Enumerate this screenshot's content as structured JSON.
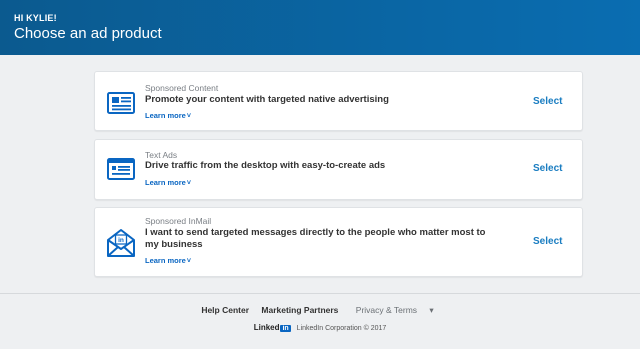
{
  "header": {
    "greeting": "HI KYLIE!",
    "title": "Choose an ad product"
  },
  "products": [
    {
      "kind": "Sponsored Content",
      "headline": "Promote your content with targeted native advertising",
      "learn_more": "Learn more",
      "select": "Select",
      "icon": "sponsored-content-icon"
    },
    {
      "kind": "Text Ads",
      "headline": "Drive traffic from the desktop with easy-to-create ads",
      "learn_more": "Learn more",
      "select": "Select",
      "icon": "text-ads-icon"
    },
    {
      "kind": "Sponsored InMail",
      "headline": "I want to send targeted messages directly to the people who matter most to my business",
      "learn_more": "Learn more",
      "select": "Select",
      "icon": "inmail-envelope-icon"
    }
  ],
  "footer": {
    "links": [
      "Help Center",
      "Marketing Partners",
      "Privacy & Terms"
    ],
    "logo_text": "Linked",
    "logo_in": "in",
    "copyright": "LinkedIn Corporation © 2017"
  },
  "colors": {
    "header": "#0a6db1",
    "accent": "#0a66c2",
    "select": "#1a7dc1"
  }
}
